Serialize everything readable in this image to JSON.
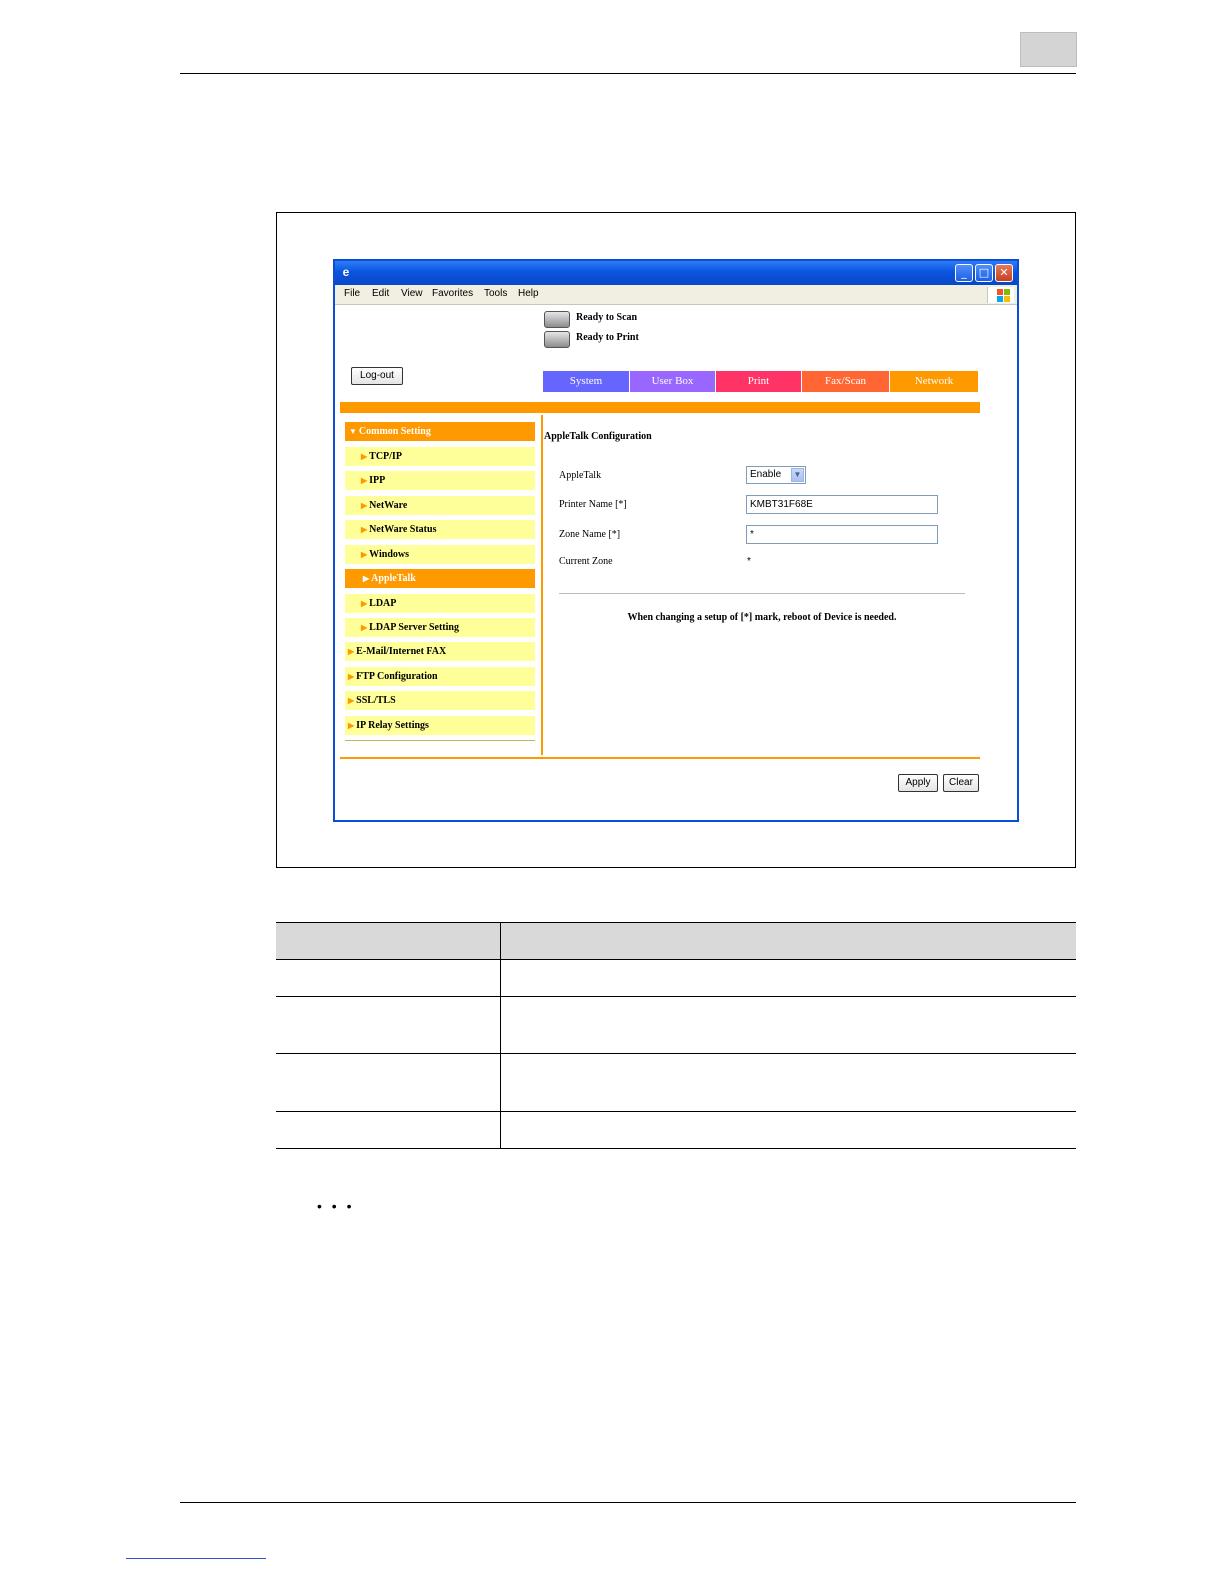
{
  "browser": {
    "menu": [
      "File",
      "Edit",
      "View",
      "Favorites",
      "Tools",
      "Help"
    ],
    "window_buttons": {
      "minimize": "_",
      "maximize": "□",
      "close": "✕"
    }
  },
  "device_status": {
    "scanner": "Ready to Scan",
    "printer": "Ready to Print"
  },
  "logout_label": "Log-out",
  "tabs": [
    {
      "label": "System",
      "color": "#6666ff"
    },
    {
      "label": "User Box",
      "color": "#9966ff"
    },
    {
      "label": "Print",
      "color": "#ff3366"
    },
    {
      "label": "Fax/Scan",
      "color": "#ff6633"
    },
    {
      "label": "Network",
      "color": "#ff9900"
    }
  ],
  "sidebar": {
    "section": "Common Setting",
    "items": [
      "TCP/IP",
      "IPP",
      "NetWare",
      "NetWare Status",
      "Windows",
      "AppleTalk",
      "LDAP",
      "LDAP Server Setting"
    ],
    "top_items": [
      "E-Mail/Internet FAX",
      "FTP Configuration",
      "SSL/TLS",
      "IP Relay Settings"
    ],
    "active": "AppleTalk"
  },
  "content": {
    "title": "AppleTalk Configuration",
    "appletalk_label": "AppleTalk",
    "appletalk_value": "Enable",
    "printer_name_label": "Printer Name [*]",
    "printer_name_value": "KMBT31F68E",
    "zone_name_label": "Zone Name [*]",
    "zone_name_value": "*",
    "current_zone_label": "Current Zone",
    "current_zone_value": "*",
    "note": "When changing a setup of [*] mark, reboot of Device is needed."
  },
  "buttons": {
    "apply": "Apply",
    "clear": "Clear"
  },
  "page": {
    "ellipsis": "• • •"
  }
}
